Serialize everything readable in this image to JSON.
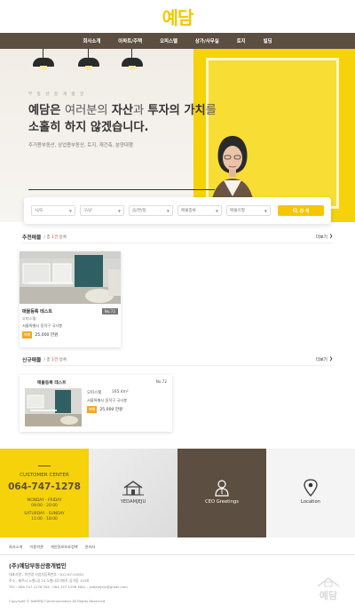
{
  "header": {
    "logo": "예담"
  },
  "nav": {
    "items": [
      "회사소개",
      "아파트/주택",
      "오피스텔",
      "상가/사무실",
      "토지",
      "빌딩"
    ]
  },
  "hero": {
    "subtitle": "부 동 산 중 개 법 인",
    "title_line1_part1": "예담은 ",
    "title_line1_part2": "여러분의 ",
    "title_line1_part3": "자산",
    "title_line1_part4": "과 ",
    "title_line1_part5": "투자의 가치",
    "title_line1_part6": "를",
    "title_line2": "소홀히 하지 않겠습니다.",
    "description": "주거용부동산, 상업용부동산, 토지, 재건축, 분양대행",
    "colors": {
      "yellow": "#f5d20a",
      "brown": "#5c4e40"
    }
  },
  "search": {
    "selects": [
      "시/도",
      "구/군",
      "읍/면/동",
      "매물종류",
      "매물유형"
    ],
    "button_label": "검 색"
  },
  "recommended": {
    "title": "추천매물",
    "count_prefix": "/ 총 ",
    "count_value": "1건",
    "count_suffix": " 등록",
    "more_label": "더보기",
    "card": {
      "title": "매물등록 테스트",
      "number": "No.72",
      "type": "오피스텔",
      "address": "서울특별시 동작구 국사봉",
      "tag": "매매",
      "price": "25,000 만원"
    }
  },
  "new_listings": {
    "title": "신규매물",
    "count_prefix": "/ 총 ",
    "count_value": "1건",
    "count_suffix": " 등록",
    "more_label": "더보기",
    "card": {
      "title": "매물등록 테스트",
      "number": "No.72",
      "type": "오피스텔",
      "area": "165.4m²",
      "address": "서울특별시 동작구 국사봉",
      "tag": "매매",
      "price": "25,000 만원"
    }
  },
  "tiles": {
    "customer_center": {
      "title": "CUSTOMER CENTER",
      "phone": "064-747-1278",
      "weekday_label": "MONDAY - FRIDAY",
      "weekday_hours": "09:00 - 20:00",
      "weekend_label": "SATURDAY - SUNDAY",
      "weekend_hours": "11:00 - 18:00"
    },
    "brand_label": "YEDAMJEJU",
    "ceo_label": "CEO Greetings",
    "location_label": "Location",
    "icons": {
      "brand": "house-icon",
      "ceo": "person-icon",
      "location": "map-pin-icon"
    }
  },
  "footer": {
    "links": [
      "회사소개",
      "이용약관",
      "개인정보보호정책",
      "관리자"
    ],
    "company": "(주)예담부동산중개법인",
    "info_line1": "대표자명 : 박선영    사업자등록번호 : 612-87-01652",
    "info_line2": "주소 : 제주시 노형1길 24 노형나무아파트 상가동 103호",
    "info_line3": "TEL : 064-747-1278    FAX : 064-747-1298    MAIL : yedamjeju@gmail.com",
    "copyright": "Copyright © NAREW Communication All Rights Reserved.",
    "logo_text": "예담"
  }
}
